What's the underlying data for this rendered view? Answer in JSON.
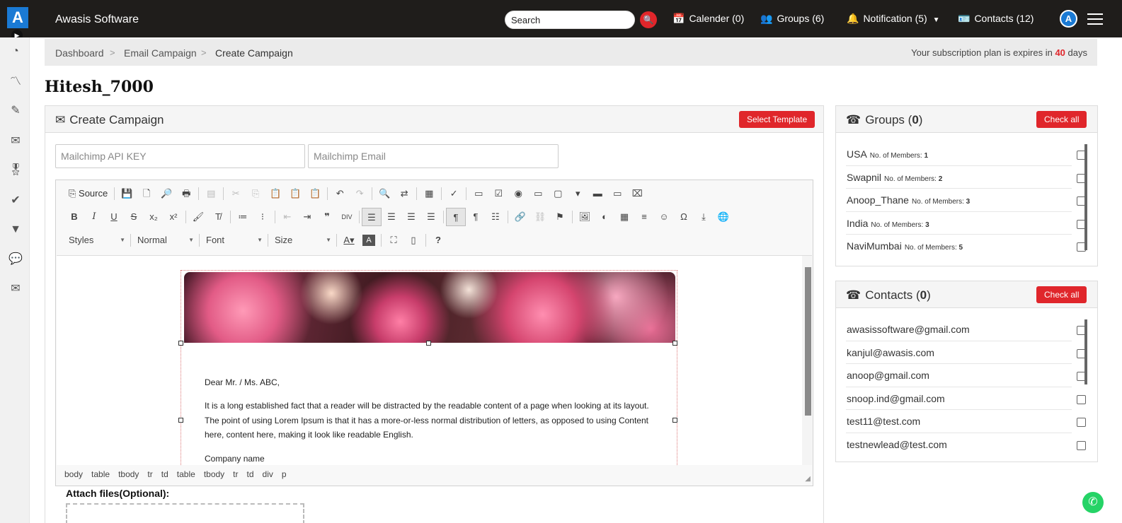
{
  "app": {
    "logo_letter": "A",
    "title": "Awasis Software"
  },
  "header": {
    "search_placeholder": "Search",
    "calendar": "Calender (0)",
    "groups": "Groups (6)",
    "notification": "Notification (5)",
    "contacts": "Contacts (12)",
    "avatar_letter": "A"
  },
  "sidebar": {
    "icons": [
      "dashboard-icon",
      "analytics-icon",
      "edit-icon",
      "email-check-icon",
      "award-icon",
      "check-circle-icon",
      "filter-icon",
      "chat-icon",
      "mail-icon"
    ]
  },
  "breadcrumb": {
    "items": [
      "Dashboard",
      "Email Campaign",
      "Create Campaign"
    ],
    "subscription_prefix": "Your subscription plan is expires in",
    "subscription_days": "40",
    "subscription_suffix": "days"
  },
  "page": {
    "title": "Hitesh_7000"
  },
  "campaign": {
    "heading": "Create Campaign",
    "select_template": "Select Template",
    "api_key_placeholder": "Mailchimp API KEY",
    "email_placeholder": "Mailchimp Email"
  },
  "editor": {
    "source_label": "Source",
    "combos": {
      "styles": "Styles",
      "format": "Normal",
      "font": "Font",
      "size": "Size"
    },
    "body": {
      "greeting": "Dear Mr. / Ms. ABC,",
      "paragraph_lines": [
        "It is a long established fact that a reader will be distracted by the readable content of a page when looking at its layout.",
        "The point of using Lorem Ipsum is that it has a more-or-less normal distribution of letters, as opposed to using Content",
        "here, content here, making it look like readable English."
      ],
      "company": "Company name"
    },
    "path": [
      "body",
      "table",
      "tbody",
      "tr",
      "td",
      "table",
      "tbody",
      "tr",
      "td",
      "div",
      "p"
    ]
  },
  "attach": {
    "label": "Attach files(Optional):"
  },
  "groups_panel": {
    "title": "Groups (",
    "count": "0",
    "title_end": ")",
    "check_all": "Check all",
    "member_label": "No. of Members:",
    "items": [
      {
        "name": "USA",
        "members": "1"
      },
      {
        "name": "Swapnil",
        "members": "2"
      },
      {
        "name": "Anoop_Thane",
        "members": "3"
      },
      {
        "name": "India",
        "members": "3"
      },
      {
        "name": "NaviMumbai",
        "members": "5"
      }
    ]
  },
  "contacts_panel": {
    "title": "Contacts (",
    "count": "0",
    "title_end": ")",
    "check_all": "Check all",
    "items": [
      "awasissoftware@gmail.com",
      "kanjul@awasis.com",
      "anoop@gmail.com",
      "snoop.ind@gmail.com",
      "test11@test.com",
      "testnewlead@test.com"
    ]
  },
  "colors": {
    "topbar": "#1f1d1b",
    "accent_red": "#e0262b",
    "brand_blue": "#1a7ad4",
    "whatsapp": "#25d366"
  }
}
